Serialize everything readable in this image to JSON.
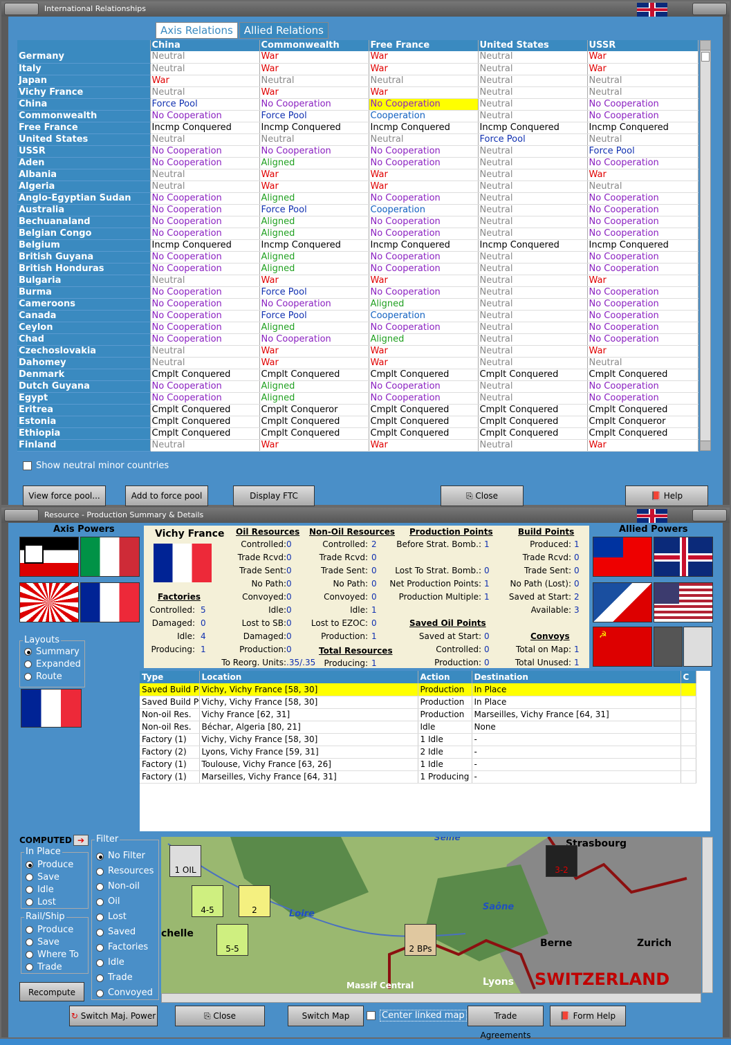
{
  "win1": {
    "title": "International Relationships"
  },
  "tabs": [
    "Axis Relations",
    "Allied Relations"
  ],
  "columns": [
    "China",
    "Commonwealth",
    "Free France",
    "United States",
    "USSR"
  ],
  "rows": [
    [
      "Germany",
      "Neutral",
      "War",
      "War",
      "Neutral",
      "War"
    ],
    [
      "Italy",
      "Neutral",
      "War",
      "War",
      "Neutral",
      "War"
    ],
    [
      "Japan",
      "War",
      "Neutral",
      "Neutral",
      "Neutral",
      "Neutral"
    ],
    [
      "Vichy France",
      "Neutral",
      "War",
      "War",
      "Neutral",
      "Neutral"
    ],
    [
      "China",
      "Force Pool",
      "No Cooperation",
      "No Cooperation",
      "Neutral",
      "No Cooperation"
    ],
    [
      "Commonwealth",
      "No Cooperation",
      "Force Pool",
      "Cooperation",
      "Neutral",
      "No Cooperation"
    ],
    [
      "Free France",
      "Incmp Conquered",
      "Incmp Conquered",
      "Incmp Conquered",
      "Incmp Conquered",
      "Incmp Conquered"
    ],
    [
      "United States",
      "Neutral",
      "Neutral",
      "Neutral",
      "Force Pool",
      "Neutral"
    ],
    [
      "USSR",
      "No Cooperation",
      "No Cooperation",
      "No Cooperation",
      "Neutral",
      "Force Pool"
    ],
    [
      "Aden",
      "No Cooperation",
      "Aligned",
      "No Cooperation",
      "Neutral",
      "No Cooperation"
    ],
    [
      "Albania",
      "Neutral",
      "War",
      "War",
      "Neutral",
      "War"
    ],
    [
      "Algeria",
      "Neutral",
      "War",
      "War",
      "Neutral",
      "Neutral"
    ],
    [
      "Anglo-Egyptian Sudan",
      "No Cooperation",
      "Aligned",
      "No Cooperation",
      "Neutral",
      "No Cooperation"
    ],
    [
      "Australia",
      "No Cooperation",
      "Force Pool",
      "Cooperation",
      "Neutral",
      "No Cooperation"
    ],
    [
      "Bechuanaland",
      "No Cooperation",
      "Aligned",
      "No Cooperation",
      "Neutral",
      "No Cooperation"
    ],
    [
      "Belgian Congo",
      "No Cooperation",
      "Aligned",
      "No Cooperation",
      "Neutral",
      "No Cooperation"
    ],
    [
      "Belgium",
      "Incmp Conquered",
      "Incmp Conquered",
      "Incmp Conquered",
      "Incmp Conquered",
      "Incmp Conquered"
    ],
    [
      "British Guyana",
      "No Cooperation",
      "Aligned",
      "No Cooperation",
      "Neutral",
      "No Cooperation"
    ],
    [
      "British Honduras",
      "No Cooperation",
      "Aligned",
      "No Cooperation",
      "Neutral",
      "No Cooperation"
    ],
    [
      "Bulgaria",
      "Neutral",
      "War",
      "War",
      "Neutral",
      "War"
    ],
    [
      "Burma",
      "No Cooperation",
      "Force Pool",
      "No Cooperation",
      "Neutral",
      "No Cooperation"
    ],
    [
      "Cameroons",
      "No Cooperation",
      "No Cooperation",
      "Aligned",
      "Neutral",
      "No Cooperation"
    ],
    [
      "Canada",
      "No Cooperation",
      "Force Pool",
      "Cooperation",
      "Neutral",
      "No Cooperation"
    ],
    [
      "Ceylon",
      "No Cooperation",
      "Aligned",
      "No Cooperation",
      "Neutral",
      "No Cooperation"
    ],
    [
      "Chad",
      "No Cooperation",
      "No Cooperation",
      "Aligned",
      "Neutral",
      "No Cooperation"
    ],
    [
      "Czechoslovakia",
      "Neutral",
      "War",
      "War",
      "Neutral",
      "War"
    ],
    [
      "Dahomey",
      "Neutral",
      "War",
      "War",
      "Neutral",
      "Neutral"
    ],
    [
      "Denmark",
      "Cmplt Conquered",
      "Cmplt Conquered",
      "Cmplt Conquered",
      "Cmplt Conquered",
      "Cmplt Conquered"
    ],
    [
      "Dutch Guyana",
      "No Cooperation",
      "Aligned",
      "No Cooperation",
      "Neutral",
      "No Cooperation"
    ],
    [
      "Egypt",
      "No Cooperation",
      "Aligned",
      "No Cooperation",
      "Neutral",
      "No Cooperation"
    ],
    [
      "Eritrea",
      "Cmplt Conquered",
      "Cmplt Conqueror",
      "Cmplt Conquered",
      "Cmplt Conquered",
      "Cmplt Conquered"
    ],
    [
      "Estonia",
      "Cmplt Conquered",
      "Cmplt Conquered",
      "Cmplt Conquered",
      "Cmplt Conquered",
      "Cmplt Conqueror"
    ],
    [
      "Ethiopia",
      "Cmplt Conquered",
      "Cmplt Conquered",
      "Cmplt Conquered",
      "Cmplt Conquered",
      "Cmplt Conquered"
    ],
    [
      "Finland",
      "Neutral",
      "War",
      "War",
      "Neutral",
      "War"
    ]
  ],
  "show_neutral": "Show neutral minor countries",
  "buttons1": [
    "View force pool...",
    "Add to force pool",
    "Display FTC",
    "Close",
    "Help"
  ],
  "win2": {
    "title": "Resource - Production Summary & Details"
  },
  "axis_powers": "Axis Powers",
  "allied_powers": "Allied Powers",
  "country": "Vichy France",
  "summary": {
    "oil_h": "Oil Resources",
    "nonoil_h": "Non-Oil Resources",
    "pp_h": "Production Points",
    "bp_h": "Build Points",
    "oil": [
      [
        "Controlled:",
        "0"
      ],
      [
        "Trade Rcvd:",
        "0"
      ],
      [
        "Trade Sent:",
        "0"
      ],
      [
        "No Path:",
        "0"
      ],
      [
        "Convoyed:",
        "0"
      ],
      [
        "Idle:",
        "0"
      ],
      [
        "Lost to SB:",
        "0"
      ],
      [
        "Damaged:",
        "0"
      ],
      [
        "Production:",
        "0"
      ],
      [
        "To Reorg. Units:",
        ".35/.35"
      ]
    ],
    "nonoil": [
      [
        "Controlled:",
        "2"
      ],
      [
        "Trade Rcvd:",
        "0"
      ],
      [
        "Trade Sent:",
        "0"
      ],
      [
        "No Path:",
        "0"
      ],
      [
        "Convoyed:",
        "0"
      ],
      [
        "Idle:",
        "1"
      ],
      [
        "Lost to EZOC:",
        "0"
      ],
      [
        "Production:",
        "1"
      ]
    ],
    "total_h": "Total Resources",
    "total": [
      [
        "Producing:",
        "1"
      ]
    ],
    "pp": [
      [
        "Before Strat. Bomb.:",
        "1"
      ],
      [
        "Lost To Strat. Bomb.:",
        "0"
      ],
      [
        "Net Production Points:",
        "1"
      ],
      [
        "Production Multiple:",
        "1"
      ]
    ],
    "saved_h": "Saved Oil Points",
    "saved": [
      [
        "Saved at Start:",
        "0"
      ],
      [
        "Controlled:",
        "0"
      ],
      [
        "Production:",
        "0"
      ]
    ],
    "bp": [
      [
        "Produced:",
        "1"
      ],
      [
        "Trade Rcvd:",
        "0"
      ],
      [
        "Trade Sent:",
        "0"
      ],
      [
        "No Path (Lost):",
        "0"
      ],
      [
        "Saved at Start:",
        "2"
      ],
      [
        "Available:",
        "3"
      ]
    ],
    "convoys_h": "Convoys",
    "convoys": [
      [
        "Total on Map:",
        "1"
      ],
      [
        "Total Unused:",
        "1"
      ]
    ],
    "fact_h": "Factories",
    "fact": [
      [
        "Controlled:",
        "5"
      ],
      [
        "Damaged:",
        "0"
      ],
      [
        "Idle:",
        "4"
      ],
      [
        "Producing:",
        "1"
      ]
    ]
  },
  "layouts": {
    "legend": "Layouts",
    "items": [
      "Summary",
      "Expanded",
      "Route"
    ],
    "selected": 0
  },
  "dcols": [
    "Type",
    "Location",
    "Action",
    "Destination",
    "C"
  ],
  "drows": [
    [
      "Saved Build Pt",
      "Vichy, Vichy France [58, 30]",
      "Production",
      "In Place"
    ],
    [
      "Saved Build Pt",
      "Vichy, Vichy France [58, 30]",
      "Production",
      "In Place"
    ],
    [
      "Non-oil Res.",
      "Vichy France [62, 31]",
      "Production",
      "Marseilles, Vichy France [64, 31]"
    ],
    [
      "Non-oil Res.",
      "Béchar, Algeria [80, 21]",
      "Idle",
      "None"
    ],
    [
      "Factory (1)",
      "Vichy, Vichy France [58, 30]",
      "1 Idle",
      "-"
    ],
    [
      "Factory (2)",
      "Lyons, Vichy France [59, 31]",
      "2 Idle",
      "-"
    ],
    [
      "Factory (1)",
      "Toulouse, Vichy France [63, 26]",
      "1 Idle",
      "-"
    ],
    [
      "Factory (1)",
      "Marseilles, Vichy France [64, 31]",
      "1 Producing",
      "-"
    ]
  ],
  "computed": "COMPUTED",
  "inplace": {
    "legend": "In Place",
    "items": [
      "Produce",
      "Save",
      "Idle",
      "Lost"
    ]
  },
  "railship": {
    "legend": "Rail/Ship",
    "items": [
      "Produce",
      "Save",
      "Where To",
      "Trade"
    ]
  },
  "filter": {
    "legend": "Filter",
    "items": [
      "No Filter",
      "Resources",
      "Non-oil",
      "Oil",
      "Lost",
      "Saved",
      "Factories",
      "Idle",
      "Trade",
      "Convoyed"
    ]
  },
  "recompute": "Recompute",
  "map": {
    "labels": [
      "Seine",
      "Strasbourg",
      "Loire",
      "Saône",
      "chelle",
      "Berne",
      "Zurich",
      "Massif Central",
      "Lyons",
      "SWITZERLAND"
    ],
    "counters": [
      "1 OIL",
      "4-5",
      "2",
      "5-5",
      "2 BPs",
      "3-2"
    ]
  },
  "buttons2": [
    "Switch Maj. Power",
    "Close",
    "Switch Map",
    "Center linked map",
    "Trade Agreements",
    "Form Help"
  ]
}
